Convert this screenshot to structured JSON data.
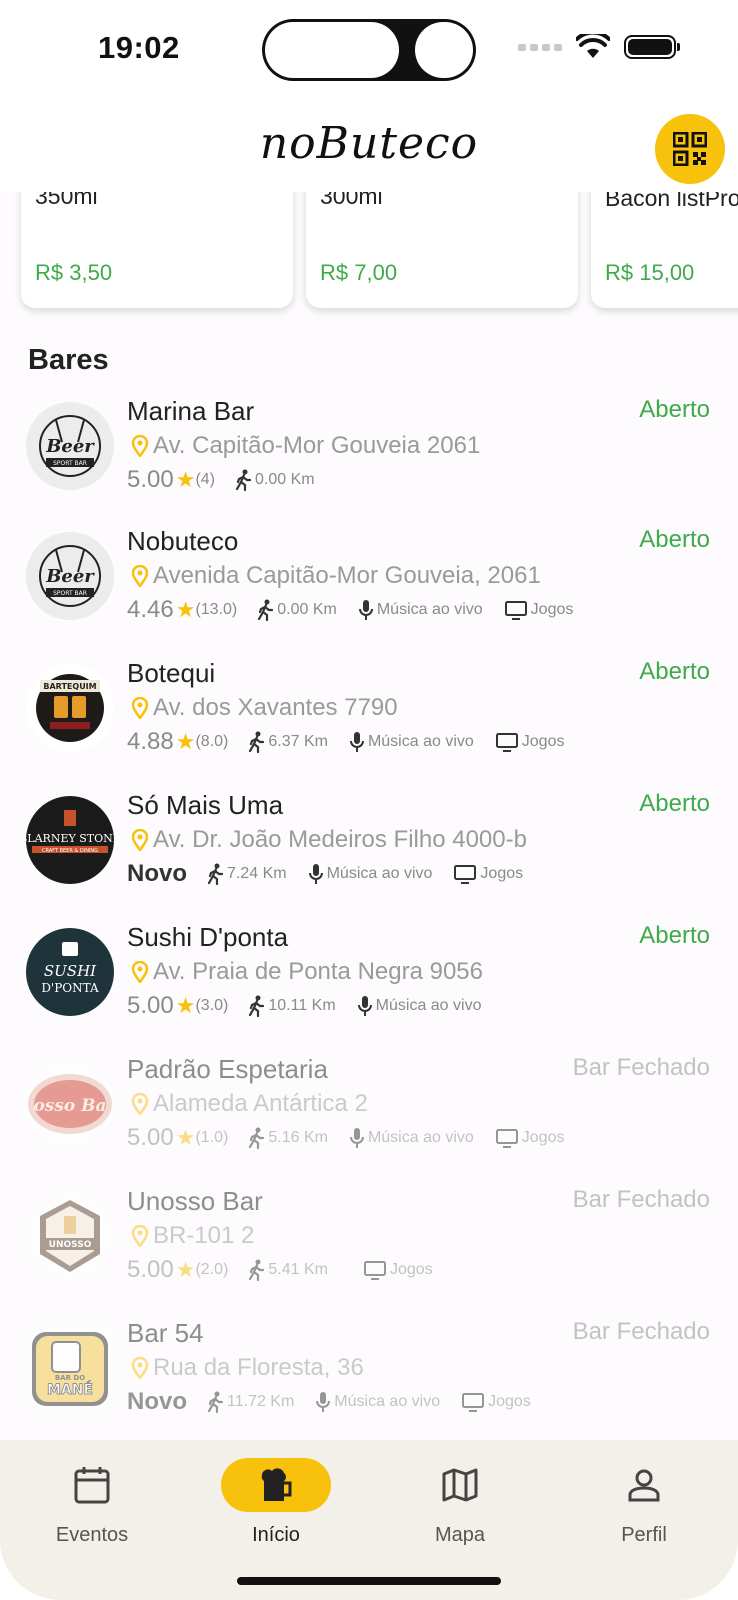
{
  "status_bar": {
    "time": "19:02"
  },
  "header": {
    "brand": "noButeco",
    "qr_icon": "qr-code-icon"
  },
  "products": [
    {
      "name": "350ml",
      "price": "R$ 3,50"
    },
    {
      "name": "300ml",
      "price": "R$ 7,00"
    },
    {
      "name": "Hamburguer\nBacon listPro",
      "price": "R$ 15,00"
    }
  ],
  "section": {
    "title": "Bares"
  },
  "bars": [
    {
      "name": "Marina Bar",
      "status": "Aberto",
      "address": "Av. Capitão-Mor Gouveia 2061",
      "rating": "5.00",
      "count": "(4)",
      "distance": "0.00 Km",
      "music": "",
      "games": ""
    },
    {
      "name": "Nobuteco",
      "status": "Aberto",
      "address": "Avenida Capitão-Mor Gouveia, 2061",
      "rating": "4.46",
      "count": "(13.0)",
      "distance": "0.00 Km",
      "music": "Música ao vivo",
      "games": "Jogos"
    },
    {
      "name": "Botequi",
      "status": "Aberto",
      "address": "Av. dos Xavantes 7790",
      "rating": "4.88",
      "count": "(8.0)",
      "distance": "6.37 Km",
      "music": "Música ao vivo",
      "games": "Jogos"
    },
    {
      "name": "Só Mais Uma",
      "status": "Aberto",
      "address": "Av. Dr. João Medeiros Filho 4000-b",
      "rating": "Novo",
      "count": "",
      "distance": "7.24 Km",
      "music": "Música ao vivo",
      "games": "Jogos"
    },
    {
      "name": "Sushi D'ponta",
      "status": "Aberto",
      "address": "Av. Praia de Ponta Negra 9056",
      "rating": "5.00",
      "count": "(3.0)",
      "distance": "10.11 Km",
      "music": "Música ao vivo",
      "games": ""
    },
    {
      "name": "Padrão Espetaria",
      "status": "Bar Fechado",
      "address": "Alameda Antártica 2",
      "rating": "5.00",
      "count": "(1.0)",
      "distance": "5.16 Km",
      "music": "Música ao vivo",
      "games": "Jogos"
    },
    {
      "name": "Unosso Bar",
      "status": "Bar Fechado",
      "address": "BR-101 2",
      "rating": "5.00",
      "count": "(2.0)",
      "distance": "5.41 Km",
      "music": "",
      "games": "Jogos"
    },
    {
      "name": "Bar 54",
      "status": "Bar Fechado",
      "address": "Rua da Floresta, 36",
      "rating": "Novo",
      "count": "",
      "distance": "11.72 Km",
      "music": "Música ao vivo",
      "games": "Jogos"
    }
  ],
  "logos": {
    "beer": "Beer",
    "beer_sub": "SPORT BAR",
    "bartequim": "BARTEQUIM",
    "blarney": "BLARNEY STONE",
    "blarney_sub": "CRAFT BEER & DINING",
    "sushi": "SUSHI",
    "sushi_sub": "D'PONTA",
    "osso": "osso Ba",
    "unosso": "UNOSSO",
    "mane_top": "BAR DO",
    "mane": "MANÉ"
  },
  "nav": [
    {
      "label": "Eventos",
      "icon": "calendar-icon"
    },
    {
      "label": "Início",
      "icon": "beer-mug-icon"
    },
    {
      "label": "Mapa",
      "icon": "map-icon"
    },
    {
      "label": "Perfil",
      "icon": "person-icon"
    }
  ],
  "colors": {
    "accent": "#f8c10c",
    "open": "#3faa4a",
    "nav_bg": "#f3f0ea"
  }
}
